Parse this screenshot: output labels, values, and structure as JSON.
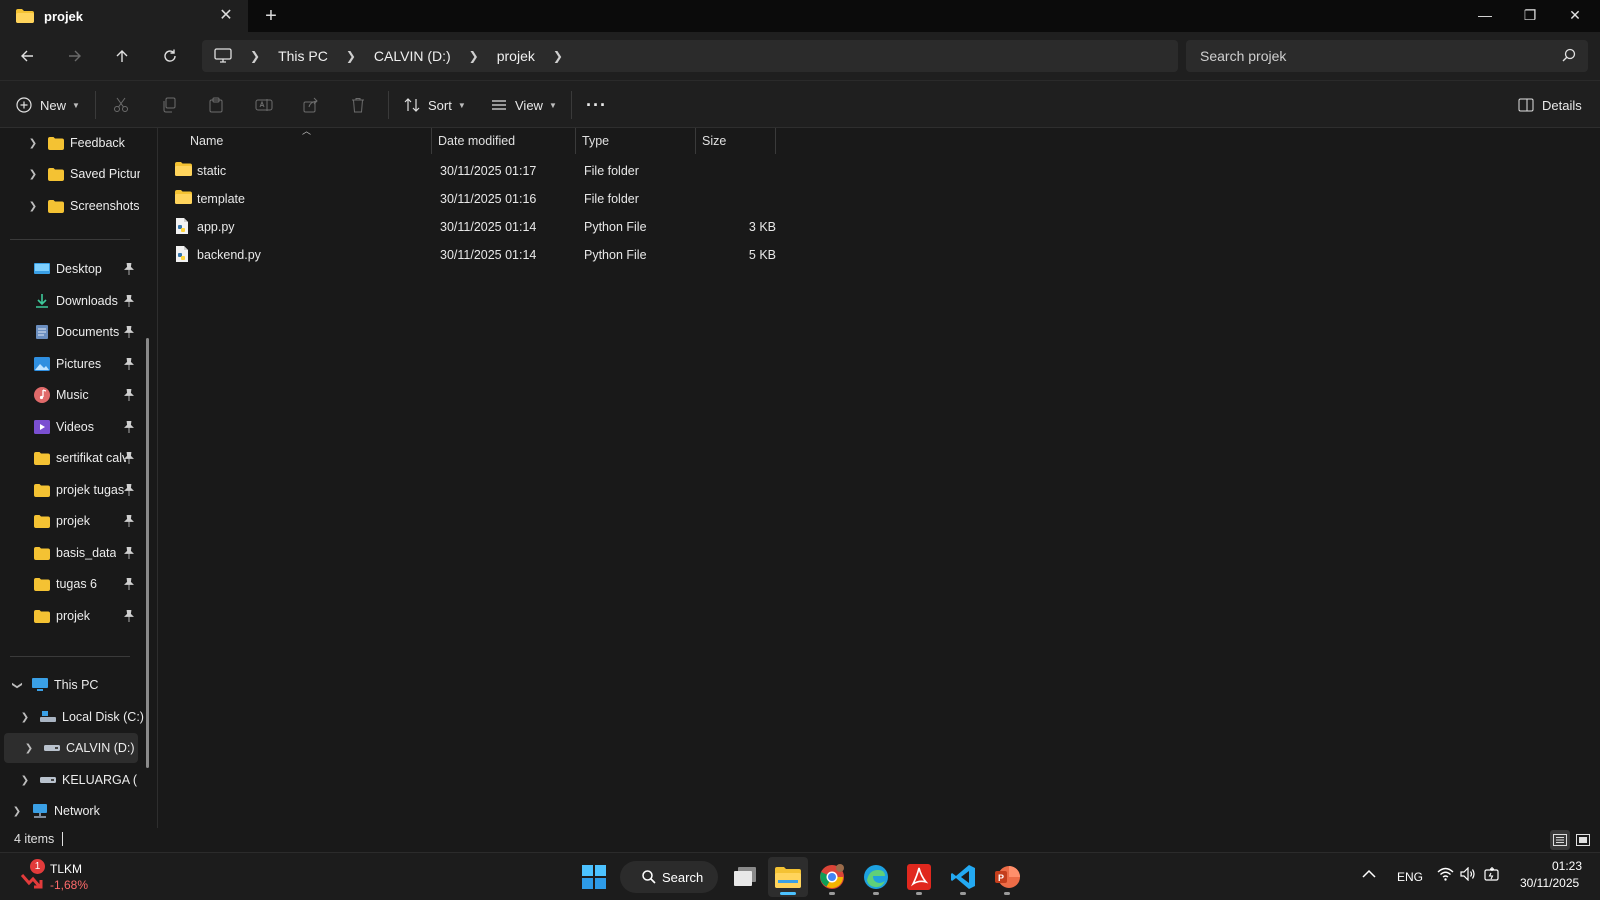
{
  "window": {
    "tab_title": "projek",
    "tab_close": "✕",
    "new_tab": "+",
    "minimize": "—",
    "maximize": "❐",
    "close": "✕"
  },
  "address": {
    "crumbs": [
      "This PC",
      "CALVIN (D:)",
      "projek"
    ],
    "search_placeholder": "Search projek"
  },
  "commands": {
    "new_label": "New",
    "sort_label": "Sort",
    "view_label": "View",
    "more_label": "···",
    "details_label": "Details"
  },
  "sidebar": {
    "top_items": [
      "Feedback",
      "Saved Pictures",
      "Screenshots"
    ],
    "pinned": [
      "Desktop",
      "Downloads",
      "Documents",
      "Pictures",
      "Music",
      "Videos",
      "sertifikat calvin",
      "projek tugas",
      "projek",
      "basis_data",
      "tugas 6",
      "projek"
    ],
    "this_pc": "This PC",
    "drives": [
      "Local Disk (C:)",
      "CALVIN (D:)",
      "KELUARGA (E:)"
    ],
    "network": "Network"
  },
  "file_list": {
    "columns": [
      "Name",
      "Date modified",
      "Type",
      "Size"
    ],
    "rows": [
      {
        "name": "static",
        "date": "30/11/2025 01:17",
        "type": "File folder",
        "size": "",
        "kind": "folder"
      },
      {
        "name": "template",
        "date": "30/11/2025 01:16",
        "type": "File folder",
        "size": "",
        "kind": "folder"
      },
      {
        "name": "app.py",
        "date": "30/11/2025 01:14",
        "type": "Python File",
        "size": "3 KB",
        "kind": "python"
      },
      {
        "name": "backend.py",
        "date": "30/11/2025 01:14",
        "type": "Python File",
        "size": "5 KB",
        "kind": "python"
      }
    ]
  },
  "status": {
    "item_count": "4 items"
  },
  "taskbar": {
    "stock_symbol": "TLKM",
    "stock_change": "-1,68%",
    "stock_badge": "1",
    "search_label": "Search",
    "language": "ENG",
    "time": "01:23",
    "date": "30/11/2025"
  },
  "colors": {
    "folder": "#f4c233",
    "accent": "#4cc2ff",
    "stock_negative": "#ff6b6b"
  }
}
